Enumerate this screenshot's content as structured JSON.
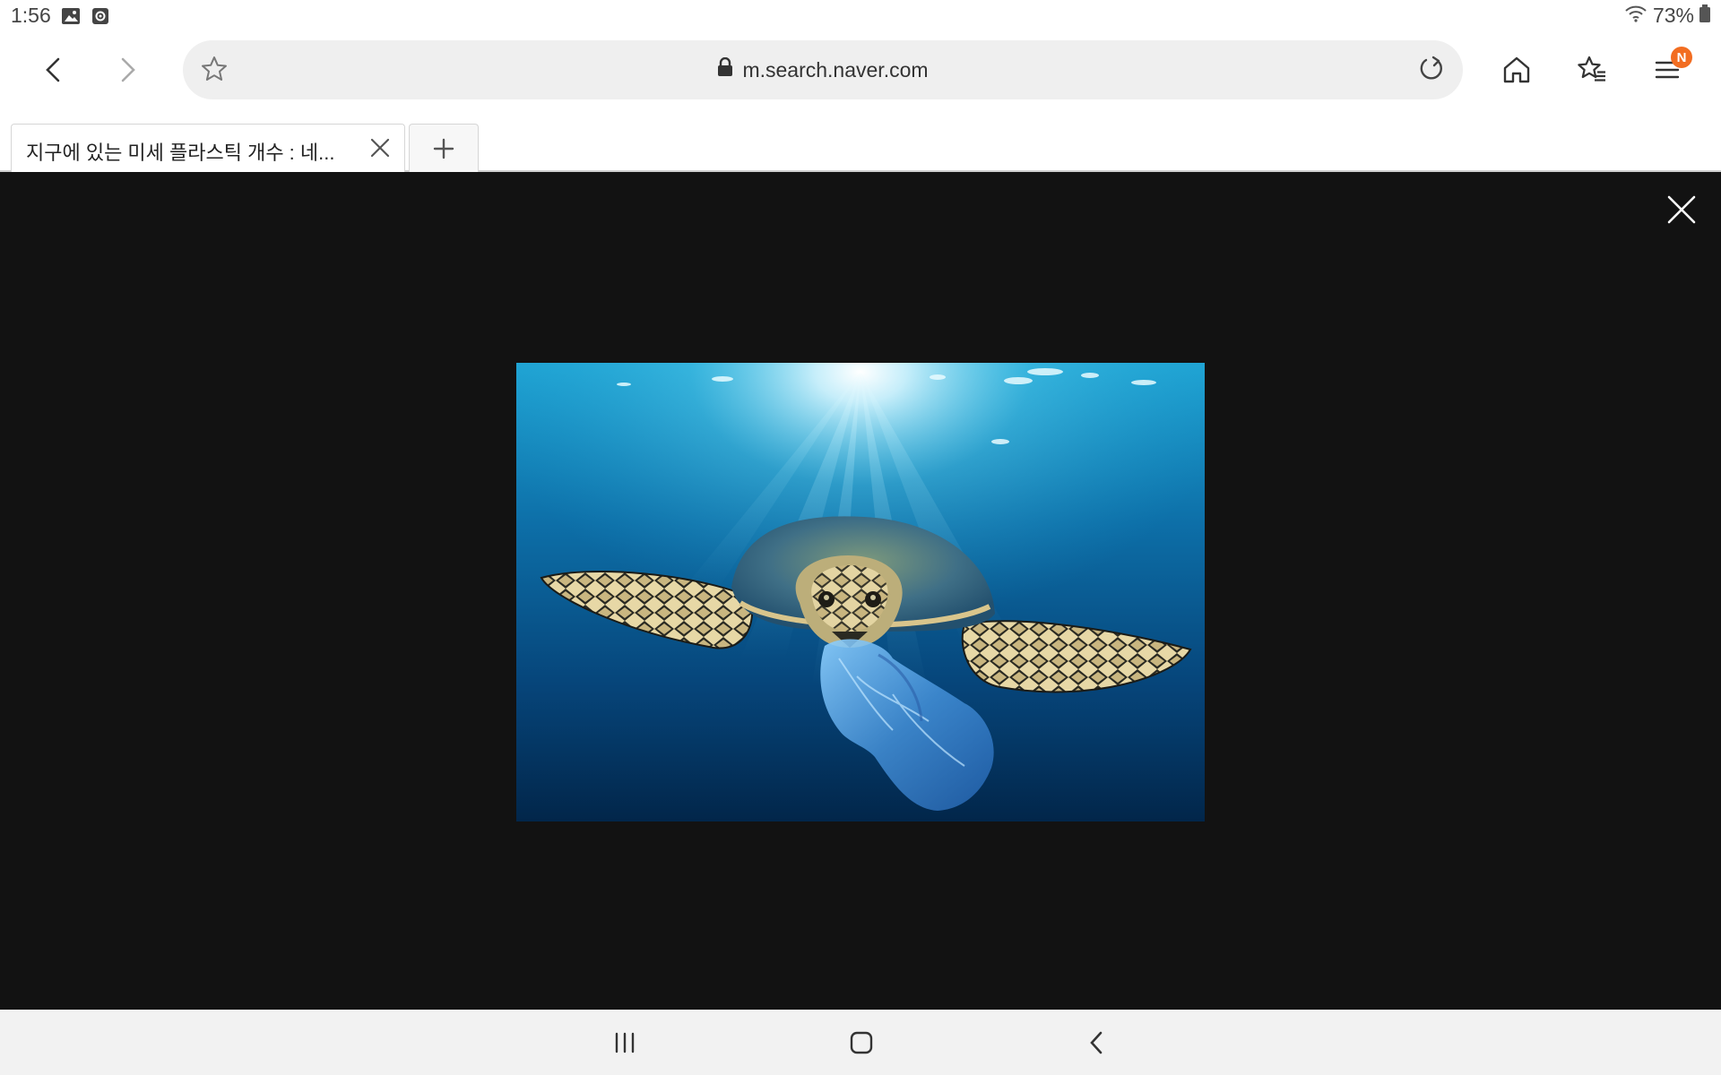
{
  "status_bar": {
    "time": "1:56",
    "battery": "73%",
    "icons": [
      "gallery-icon",
      "screen-record-icon",
      "wifi-icon",
      "battery-icon"
    ]
  },
  "toolbar": {
    "url": "m.search.naver.com",
    "menu_badge": "N",
    "icons": [
      "back-icon",
      "forward-icon",
      "bookmark-star-icon",
      "lock-icon",
      "reload-icon",
      "home-icon",
      "bookmarks-icon",
      "menu-icon"
    ],
    "badge_color": "#f26d21"
  },
  "tabs": [
    {
      "title": "지구에 있는 미세 플라스틱 개수 : 네..."
    }
  ],
  "viewer": {
    "background": "#121212",
    "image_subject": "sea-turtle-with-plastic-bag"
  },
  "navbar": {
    "icons": [
      "recent-apps-icon",
      "home-icon",
      "back-icon"
    ]
  }
}
